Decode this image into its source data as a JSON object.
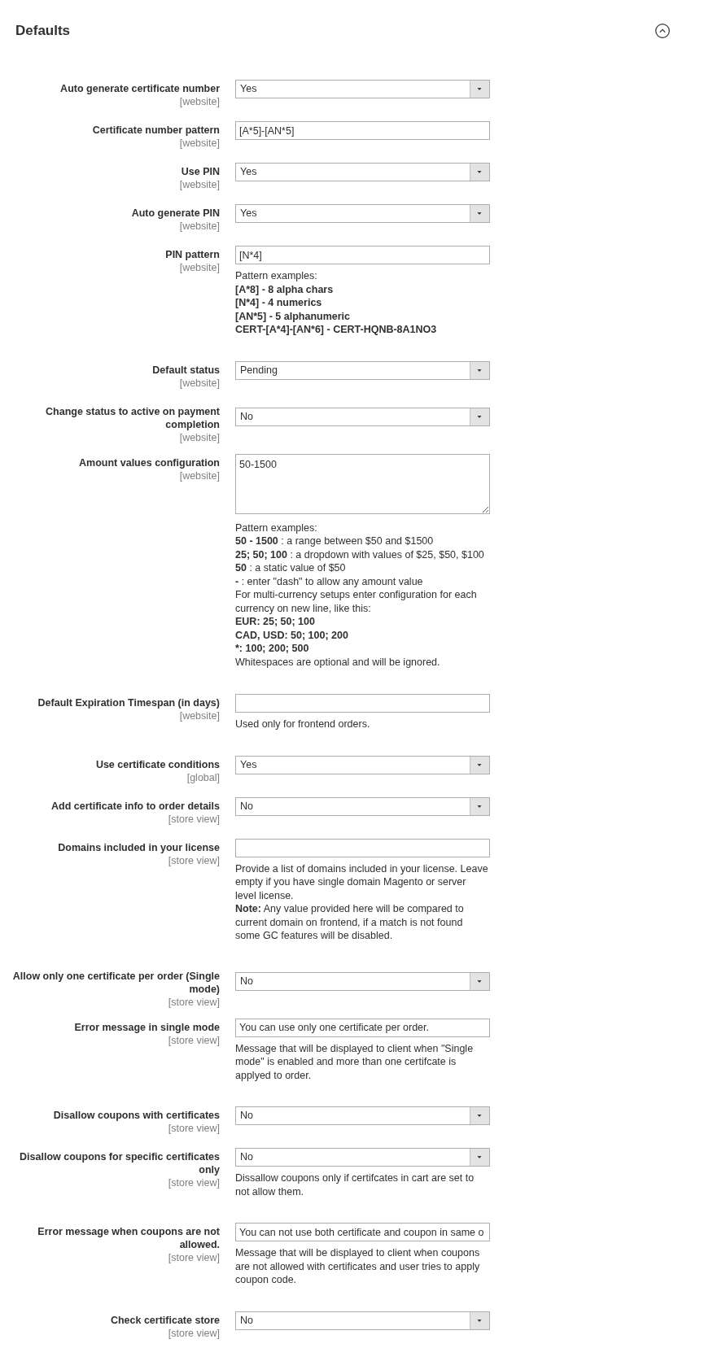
{
  "section": {
    "title": "Defaults",
    "expanded": true
  },
  "fields": [
    {
      "label": "Auto generate certificate number",
      "scope": "[website]",
      "kind": "select",
      "value": "Yes"
    },
    {
      "label": "Certificate number pattern",
      "scope": "[website]",
      "kind": "input",
      "value": "[A*5]-[AN*5]"
    },
    {
      "label": "Use PIN",
      "scope": "[website]",
      "kind": "select",
      "value": "Yes"
    },
    {
      "label": "Auto generate PIN",
      "scope": "[website]",
      "kind": "select",
      "value": "Yes"
    },
    {
      "label": "PIN pattern",
      "scope": "[website]",
      "kind": "input",
      "value": "[N*4]",
      "comment": [
        [
          {
            "text": "Pattern examples:",
            "bold": false
          }
        ],
        [
          {
            "text": "[A*8] - 8 alpha chars",
            "bold": true
          }
        ],
        [
          {
            "text": "[N*4] - 4 numerics",
            "bold": true
          }
        ],
        [
          {
            "text": "[AN*5] - 5 alphanumeric",
            "bold": true
          }
        ],
        [
          {
            "text": "CERT-[A*4]-[AN*6] - CERT-HQNB-8A1NO3",
            "bold": true
          }
        ]
      ]
    },
    {
      "label": "Default status",
      "scope": "[website]",
      "kind": "select",
      "value": "Pending"
    },
    {
      "label": "Change status to active on payment completion",
      "scope": "[website]",
      "kind": "select",
      "value": "No"
    },
    {
      "label": "Amount values configuration",
      "scope": "[website]",
      "kind": "textarea",
      "value": "50-1500",
      "comment": [
        [
          {
            "text": "Pattern examples:",
            "bold": false
          }
        ],
        [
          {
            "text": "50 - 1500",
            "bold": true
          },
          {
            "text": ": a range between $50 and $1500",
            "bold": false
          }
        ],
        [
          {
            "text": "25; 50; 100",
            "bold": true
          },
          {
            "text": ": a dropdown with values of $25, $50, $100",
            "bold": false
          }
        ],
        [
          {
            "text": "50",
            "bold": true
          },
          {
            "text": ": a static value of $50",
            "bold": false
          }
        ],
        [
          {
            "text": "-",
            "bold": true
          },
          {
            "text": ": enter \"dash\" to allow any amount value",
            "bold": false
          }
        ],
        [
          {
            "text": "For multi-currency setups enter configuration for each currency on new line, like this:",
            "bold": false
          }
        ],
        [
          {
            "text": "EUR: 25; 50; 100",
            "bold": true
          }
        ],
        [
          {
            "text": "CAD, USD: 50; 100; 200",
            "bold": true
          }
        ],
        [
          {
            "text": "*: 100; 200; 500",
            "bold": true
          }
        ],
        [
          {
            "text": "Whitespaces are optional and will be ignored.",
            "bold": false
          }
        ]
      ]
    },
    {
      "label": "Default Expiration Timespan (in days)",
      "scope": "[website]",
      "kind": "input",
      "comment": [
        [
          {
            "text": "Used only for frontend orders.",
            "bold": false
          }
        ]
      ]
    },
    {
      "label": "Use certificate conditions",
      "scope": "[global]",
      "kind": "select",
      "value": "Yes"
    },
    {
      "label": "Add certificate info to order details",
      "scope": "[store view]",
      "kind": "select",
      "value": "No"
    },
    {
      "label": "Domains included in your license",
      "scope": "[store view]",
      "kind": "input",
      "comment": [
        [
          {
            "text": "Provide a list of domains included in your license. Leave empty if you have single domain Magento or server level license.",
            "bold": false
          }
        ],
        [
          {
            "text": "Note:",
            "bold": true
          },
          {
            "text": "Any value provided here will be compared to current domain on frontend, if a match is not found some GC features will be disabled.",
            "bold": false
          }
        ]
      ]
    },
    {
      "label": "Allow only one certificate per order (Single mode)",
      "scope": "[store view]",
      "kind": "select",
      "value": "No"
    },
    {
      "label": "Error message in single mode",
      "scope": "[store view]",
      "kind": "input",
      "value": "You can use only one certificate per order.",
      "comment": [
        [
          {
            "text": "Message that will be displayed to client when \"Single mode\" is enabled and more than one certifcate is applyed to order.",
            "bold": false
          }
        ]
      ]
    },
    {
      "label": "Disallow coupons with certificates",
      "scope": "[store view]",
      "kind": "select",
      "value": "No"
    },
    {
      "label": "Disallow coupons for specific certificates only",
      "scope": "[store view]",
      "kind": "select",
      "value": "No",
      "comment": [
        [
          {
            "text": "Dissallow coupons only if certifcates in cart are set to not allow them.",
            "bold": false
          }
        ]
      ]
    },
    {
      "label": "Error message when coupons are not allowed.",
      "scope": "[store view]",
      "kind": "input",
      "value": "You can not use both certificate and coupon in same o",
      "comment": [
        [
          {
            "text": "Message that will be displayed to client when coupons are not allowed with certificates and user tries to apply coupon code.",
            "bold": false
          }
        ]
      ]
    },
    {
      "label": "Check certificate store",
      "scope": "[store view]",
      "kind": "select",
      "value": "No"
    }
  ]
}
